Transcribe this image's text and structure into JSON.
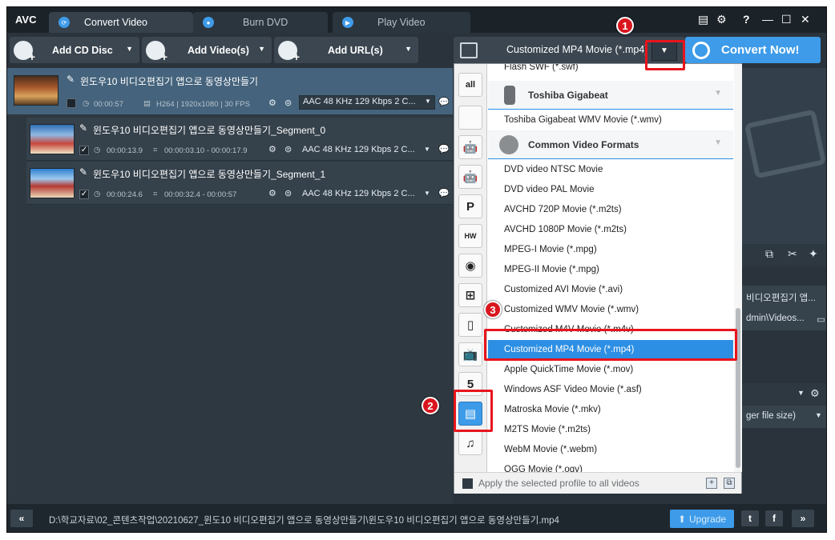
{
  "app": {
    "logo": "AVC",
    "tabs": [
      "Convert Video",
      "Burn DVD",
      "Play Video"
    ],
    "window_controls": {
      "help": "?",
      "minimize": "—",
      "maximize": "☐",
      "close": "✕"
    }
  },
  "toolbar": {
    "add_cd": "Add CD Disc",
    "add_video": "Add Video(s)",
    "add_url": "Add URL(s)",
    "profile_selected": "Customized MP4 Movie (*.mp4)",
    "convert": "Convert Now!"
  },
  "files": {
    "main": {
      "title": "윈도우10 비디오편집기 앱으로 동영상만들기",
      "duration": "00:00:57",
      "video_info": "H264 | 1920x1080 | 30 FPS",
      "audio": "AAC 48 KHz 129 Kbps 2 C..."
    },
    "segments": [
      {
        "title": "윈도우10 비디오편집기 앱으로 동영상만들기_Segment_0",
        "duration": "00:00:13.9",
        "range": "00:00:03.10 - 00:00:17.9",
        "audio": "AAC 48 KHz 129 Kbps 2 C..."
      },
      {
        "title": "윈도우10 비디오편집기 앱으로 동영상만들기_Segment_1",
        "duration": "00:00:24.6",
        "range": "00:00:32.4 - 00:00:57",
        "audio": "AAC 48 KHz 129 Kbps 2 C..."
      }
    ]
  },
  "dropdown": {
    "categories": [
      "all",
      "apple",
      "android-s",
      "android",
      "playstation",
      "huawei",
      "lg",
      "windows",
      "mobile",
      "tv",
      "html5",
      "video",
      "music"
    ],
    "selected_category": "video",
    "top_item": "Flash SWF (*.swf)",
    "groups": [
      {
        "name": "Toshiba Gigabeat",
        "items": [
          "Toshiba Gigabeat WMV Movie (*.wmv)"
        ]
      },
      {
        "name": "Common Video Formats",
        "items": []
      }
    ],
    "items": [
      "DVD video NTSC Movie",
      "DVD video PAL Movie",
      "AVCHD 720P Movie (*.m2ts)",
      "AVCHD 1080P Movie (*.m2ts)",
      "MPEG-I Movie (*.mpg)",
      "MPEG-II Movie (*.mpg)",
      "Customized AVI Movie (*.avi)",
      "Customized WMV Movie (*.wmv)",
      "Customized M4V Movie (*.m4v)",
      "Customized MP4 Movie (*.mp4)",
      "Apple QuickTime Movie (*.mov)",
      "Windows ASF Video Movie (*.asf)",
      "Matroska Movie (*.mkv)",
      "M2TS Movie (*.m2ts)",
      "WebM Movie (*.webm)",
      "OGG Movie (*.ogv)"
    ],
    "selected_item": "Customized MP4 Movie (*.mp4)",
    "footer": "Apply the selected profile to all videos"
  },
  "right_panel": {
    "name_field": "비디오편집기 앱...",
    "folder_field": "dmin\\Videos...",
    "size_option": "ger file size)"
  },
  "bottom": {
    "path": "D:\\학교자료\\02_콘텐츠작업\\20210627_윈도10 비디오편집기 앱으로 동영상만들기\\윈도우10 비디오편집기 앱으로 동영상만들기.mp4",
    "upgrade": "Upgrade",
    "collapse": "«",
    "expand": "»",
    "twitter": "t",
    "facebook": "f"
  },
  "annotations": [
    "1",
    "2",
    "3"
  ],
  "colors": {
    "accent": "#3d9be9",
    "highlight_red": "#e8141c",
    "dark_bg": "#2a333b"
  }
}
